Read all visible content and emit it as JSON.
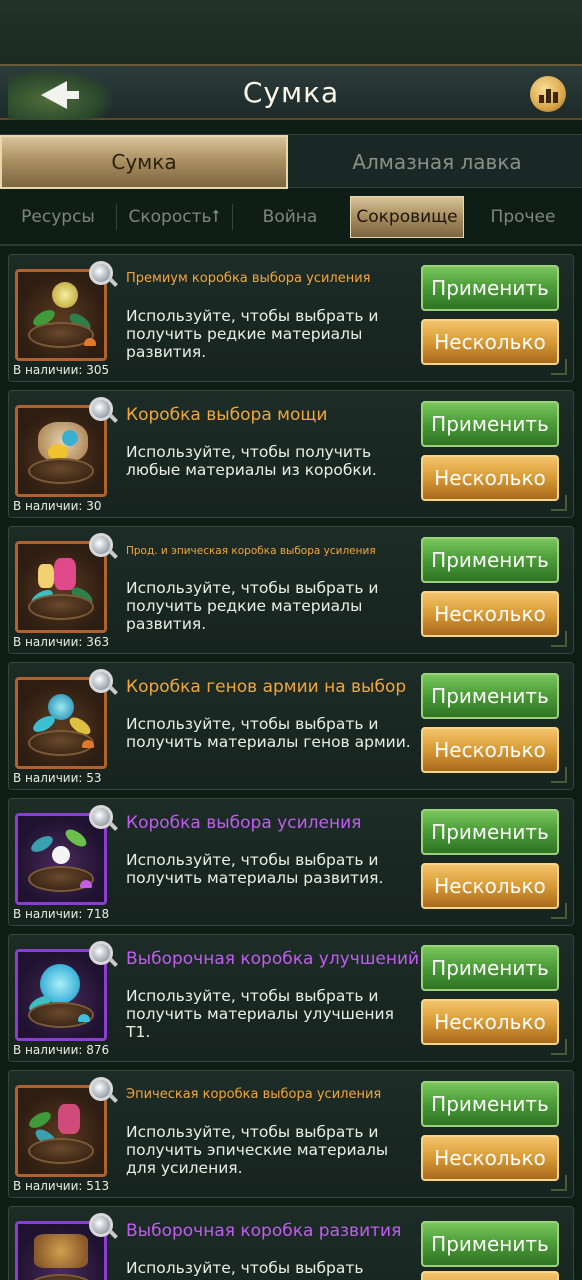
{
  "header": {
    "title": "Сумка"
  },
  "main_tabs": [
    {
      "label": "Сумка",
      "active": true
    },
    {
      "label": "Алмазная лавка",
      "active": false
    }
  ],
  "sub_tabs": [
    {
      "label": "Ресурсы",
      "active": false
    },
    {
      "label": "Скорость⭡",
      "active": false
    },
    {
      "label": "Война",
      "active": false
    },
    {
      "label": "Сокровище",
      "active": true
    },
    {
      "label": "Прочее",
      "active": false
    }
  ],
  "buttons": {
    "apply": "Применить",
    "multiple": "Несколько"
  },
  "items": [
    {
      "title": "Премиум коробка выбора усиления",
      "desc": "Используйте, чтобы выбрать и получить редкие материалы развития.",
      "stock": "В наличии: 305",
      "rarity": "orange",
      "icon": "premium-boost-box-icon"
    },
    {
      "title": "Коробка выбора мощи",
      "desc": "Используйте, чтобы получить любые материалы из коробки.",
      "stock": "В наличии: 30",
      "rarity": "orange",
      "icon": "power-choice-box-icon"
    },
    {
      "title": "Прод. и эпическая коробка выбора усиления",
      "desc": "Используйте, чтобы выбрать и получить редкие материалы развития.",
      "stock": "В наличии: 363",
      "rarity": "orange",
      "icon": "advanced-epic-boost-box-icon"
    },
    {
      "title": "Коробка генов армии на выбор",
      "desc": "Используйте, чтобы выбрать и получить материалы генов армии.",
      "stock": "В наличии: 53",
      "rarity": "orange",
      "icon": "army-genes-box-icon"
    },
    {
      "title": "Коробка выбора усиления",
      "desc": "Используйте, чтобы выбрать и получить материалы развития.",
      "stock": "В наличии: 718",
      "rarity": "purple",
      "icon": "boost-choice-box-icon"
    },
    {
      "title": "Выборочная коробка улучшений",
      "desc": "Используйте, чтобы выбрать и получить материалы улучшения T1.",
      "stock": "В наличии: 876",
      "rarity": "purple",
      "icon": "upgrade-choice-box-icon"
    },
    {
      "title": "Эпическая коробка выбора усиления",
      "desc": "Используйте, чтобы выбрать и получить эпические материалы для усиления.",
      "stock": "В наличии: 513",
      "rarity": "orange",
      "icon": "epic-boost-box-icon"
    },
    {
      "title": "Выборочная коробка развития",
      "desc": "Используйте, чтобы выбрать",
      "stock": "",
      "rarity": "purple",
      "icon": "development-choice-box-icon"
    }
  ],
  "colors": {
    "rarity_orange": "#f2a63a",
    "rarity_purple": "#c15cf2",
    "apply_green": "#4a9a36",
    "multiple_gold": "#d79a36"
  }
}
